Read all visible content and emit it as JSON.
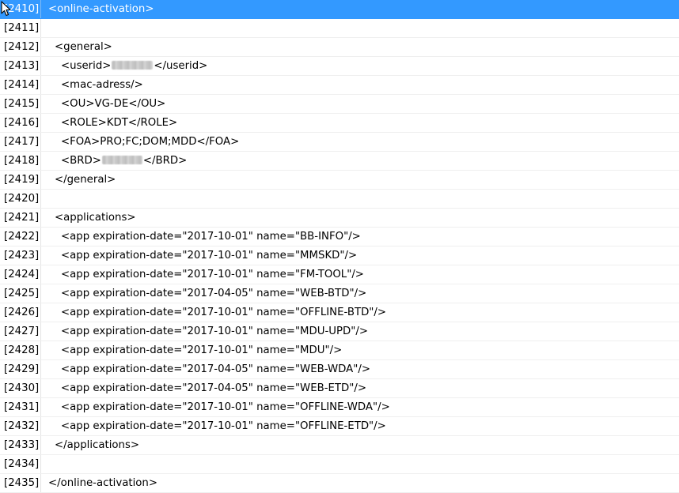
{
  "rows": [
    {
      "line": "[2410]",
      "text": "<online-activation>",
      "indent": 0,
      "selected": true
    },
    {
      "line": "[2411]",
      "text": "",
      "indent": 0
    },
    {
      "line": "[2412]",
      "text": "<general>",
      "indent": 1
    },
    {
      "line": "[2413]",
      "text": "<userid>",
      "after": "</userid>",
      "indent": 2,
      "redacted": 52
    },
    {
      "line": "[2414]",
      "text": "<mac-adress/>",
      "indent": 2
    },
    {
      "line": "[2415]",
      "text": "<OU>VG-DE</OU>",
      "indent": 2
    },
    {
      "line": "[2416]",
      "text": "<ROLE>KDT</ROLE>",
      "indent": 2
    },
    {
      "line": "[2417]",
      "text": "<FOA>PRO;FC;DOM;MDD</FOA>",
      "indent": 2
    },
    {
      "line": "[2418]",
      "text": "<BRD>",
      "after": "</BRD>",
      "indent": 2,
      "redacted": 51
    },
    {
      "line": "[2419]",
      "text": "</general>",
      "indent": 1
    },
    {
      "line": "[2420]",
      "text": "",
      "indent": 0
    },
    {
      "line": "[2421]",
      "text": "<applications>",
      "indent": 1
    },
    {
      "line": "[2422]",
      "text": "<app expiration-date=\"2017-10-01\" name=\"BB-INFO\"/>",
      "indent": 2
    },
    {
      "line": "[2423]",
      "text": "<app expiration-date=\"2017-10-01\" name=\"MMSKD\"/>",
      "indent": 2
    },
    {
      "line": "[2424]",
      "text": "<app expiration-date=\"2017-10-01\" name=\"FM-TOOL\"/>",
      "indent": 2
    },
    {
      "line": "[2425]",
      "text": "<app expiration-date=\"2017-04-05\" name=\"WEB-BTD\"/>",
      "indent": 2
    },
    {
      "line": "[2426]",
      "text": "<app expiration-date=\"2017-10-01\" name=\"OFFLINE-BTD\"/>",
      "indent": 2
    },
    {
      "line": "[2427]",
      "text": "<app expiration-date=\"2017-10-01\" name=\"MDU-UPD\"/>",
      "indent": 2
    },
    {
      "line": "[2428]",
      "text": "<app expiration-date=\"2017-10-01\" name=\"MDU\"/>",
      "indent": 2
    },
    {
      "line": "[2429]",
      "text": "<app expiration-date=\"2017-04-05\" name=\"WEB-WDA\"/>",
      "indent": 2
    },
    {
      "line": "[2430]",
      "text": "<app expiration-date=\"2017-04-05\" name=\"WEB-ETD\"/>",
      "indent": 2
    },
    {
      "line": "[2431]",
      "text": "<app expiration-date=\"2017-10-01\" name=\"OFFLINE-WDA\"/>",
      "indent": 2
    },
    {
      "line": "[2432]",
      "text": "<app expiration-date=\"2017-10-01\" name=\"OFFLINE-ETD\"/>",
      "indent": 2
    },
    {
      "line": "[2433]",
      "text": "</applications>",
      "indent": 1
    },
    {
      "line": "[2434]",
      "text": "",
      "indent": 0
    },
    {
      "line": "[2435]",
      "text": "</online-activation>",
      "indent": 0
    }
  ],
  "colors": {
    "selection": "#3399ff",
    "row_separator": "#efefef",
    "gutter_separator": "#e4e4e4"
  },
  "icons": {
    "cursor": "mouse-pointer-icon"
  }
}
